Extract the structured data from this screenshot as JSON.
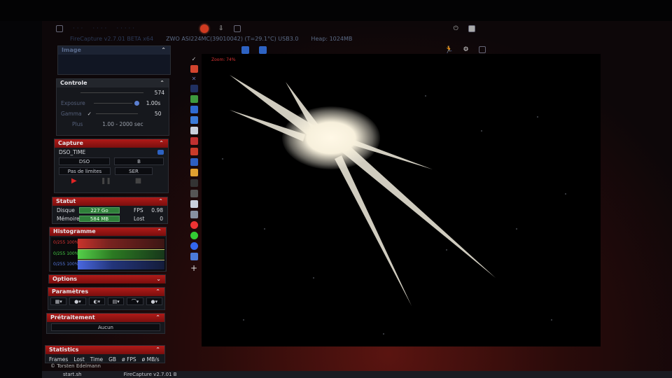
{
  "window": {
    "app_title": "FireCapture v2.7.01 BETA x64",
    "camera": "ZWO ASI224MC(39010042) (T=29.1°C) USB3.0",
    "heap": "Heap: 1024MB"
  },
  "panels": {
    "image": {
      "title": "Image"
    },
    "controle": {
      "title": "Controle",
      "gain_value": "574",
      "exposure_label": "Exposure",
      "exposure_value": "1.00s",
      "gamma_label": "Gamma",
      "gamma_value": "50",
      "plus_label": "Plus",
      "range": "1.00 - 2000 sec"
    },
    "capture": {
      "title": "Capture",
      "profile": "DSO_TIME",
      "mode": "DSO",
      "filter": "B",
      "limit": "Pas de limites",
      "format": "SER"
    },
    "statut": {
      "title": "Statut",
      "disk_label": "Disque",
      "disk_value": "227 Go",
      "memory_label": "Mémoire",
      "memory_value": "584 MB",
      "fps_label": "FPS",
      "fps_value": "0.98",
      "lost_label": "Lost",
      "lost_value": "0"
    },
    "histogram": {
      "title": "Histogramme",
      "red": "0/255 100%",
      "green": "0/255 100%",
      "blue": "0/255 100%"
    },
    "options": {
      "title": "Options"
    },
    "parametres": {
      "title": "Paramètres"
    },
    "pretraitement": {
      "title": "Prétraitement",
      "value": "Aucun"
    },
    "statistics": {
      "title": "Statistics",
      "columns": [
        "Frames",
        "Lost",
        "Time",
        "GB",
        "ø FPS",
        "ø MB/s"
      ]
    }
  },
  "view": {
    "zoom": "Zoom: 74%"
  },
  "footer": {
    "copyright": "© Torsten Edelmann",
    "task1": "start.sh",
    "task2": "FireCapture v2.7.01 B"
  },
  "colors": {
    "accent_red": "#b01a18",
    "status_green": "#2f7f3a"
  }
}
